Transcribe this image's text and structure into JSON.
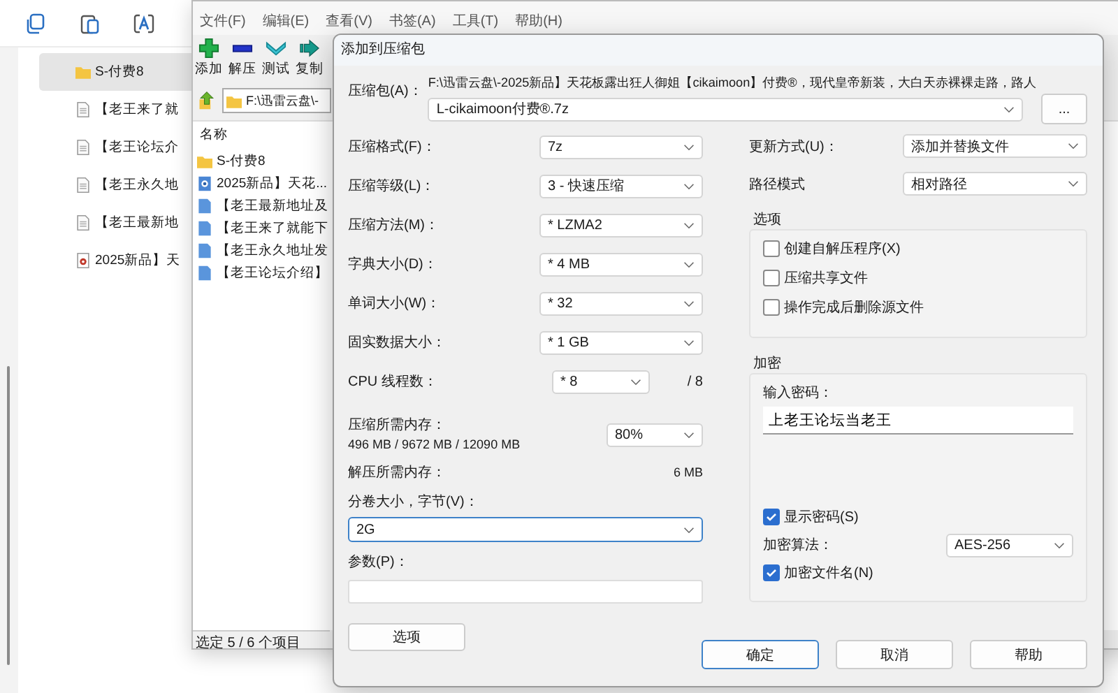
{
  "explorer": {
    "items": [
      {
        "name": "S-付费8",
        "kind": "folder",
        "selected": true
      },
      {
        "name": "【老王来了就",
        "kind": "text",
        "selected": false
      },
      {
        "name": "【老王论坛介",
        "kind": "text",
        "selected": false
      },
      {
        "name": "【老王永久地",
        "kind": "text",
        "selected": false
      },
      {
        "name": "【老王最新地",
        "kind": "text",
        "selected": false
      },
      {
        "name": "2025新品】天",
        "kind": "archive",
        "selected": false
      }
    ]
  },
  "archiver": {
    "menu": [
      "文件(F)",
      "编辑(E)",
      "查看(V)",
      "书签(A)",
      "工具(T)",
      "帮助(H)"
    ],
    "toolbar": [
      {
        "label": "添加",
        "kind": "add"
      },
      {
        "label": "解压",
        "kind": "extract"
      },
      {
        "label": "测试",
        "kind": "test"
      },
      {
        "label": "复制",
        "kind": "copy"
      }
    ],
    "address": "F:\\迅雷云盘\\-",
    "list": {
      "column": "名称",
      "items": [
        {
          "name": "S-付费8",
          "kind": "folder"
        },
        {
          "name": "2025新品】天花...",
          "kind": "archive"
        },
        {
          "name": "【老王最新地址及",
          "kind": "doc"
        },
        {
          "name": "【老王来了就能下",
          "kind": "doc"
        },
        {
          "name": "【老王永久地址发",
          "kind": "doc"
        },
        {
          "name": "【老王论坛介绍】",
          "kind": "doc"
        }
      ]
    },
    "status_bar": "选定 5 / 6 个项目"
  },
  "dialog": {
    "title": "添加到压缩包",
    "archive": {
      "label": "压缩包(A)：",
      "path": "F:\\迅雷云盘\\-2025新品】天花板露出狂人御姐【cikaimoon】付费®，现代皇帝新装，大白天赤裸裸走路，路人",
      "value": "L-cikaimoon付费®.7z",
      "browse": "..."
    },
    "left": [
      {
        "kind": "select",
        "label": "压缩格式(F)：",
        "value": "7z"
      },
      {
        "kind": "select",
        "label": "压缩等级(L)：",
        "value": "3 - 快速压缩"
      },
      {
        "kind": "select",
        "label": "压缩方法(M)：",
        "value": "* LZMA2"
      },
      {
        "kind": "select",
        "label": "字典大小(D)：",
        "value": "* 4 MB"
      },
      {
        "kind": "select",
        "label": "单词大小(W)：",
        "value": "* 32"
      },
      {
        "kind": "select",
        "label": "固实数据大小：",
        "value": "* 1 GB"
      },
      {
        "kind": "threads",
        "label": "CPU 线程数：",
        "value": "* 8",
        "suffix": "/ 8"
      },
      {
        "kind": "memory",
        "label": "压缩所需内存：",
        "detail": "496 MB / 9672 MB / 12090 MB",
        "value": "80%"
      },
      {
        "kind": "readout",
        "label": "解压所需内存：",
        "value": "6 MB"
      }
    ],
    "volume": {
      "label": "分卷大小，字节(V)：",
      "value": "2G",
      "focused": true
    },
    "params": {
      "label": "参数(P)："
    },
    "options_button": "选项",
    "update": {
      "label": "更新方式(U)：",
      "value": "添加并替换文件"
    },
    "path_mode": {
      "label": "路径模式",
      "value": "相对路径"
    },
    "options": {
      "title": "选项",
      "items": [
        {
          "label": "创建自解压程序(X)",
          "checked": false
        },
        {
          "label": "压缩共享文件",
          "checked": false
        },
        {
          "label": "操作完成后删除源文件",
          "checked": false
        }
      ]
    },
    "encryption": {
      "title": "加密",
      "password_label": "输入密码：",
      "password": "上老王论坛当老王",
      "show_password": {
        "label": "显示密码(S)",
        "checked": true
      },
      "method_label": "加密算法：",
      "method": "AES-256",
      "encrypt_names": {
        "label": "加密文件名(N)",
        "checked": true
      }
    },
    "buttons": [
      {
        "label": "确定",
        "default": true
      },
      {
        "label": "取消",
        "default": false
      },
      {
        "label": "帮助",
        "default": false
      }
    ]
  }
}
